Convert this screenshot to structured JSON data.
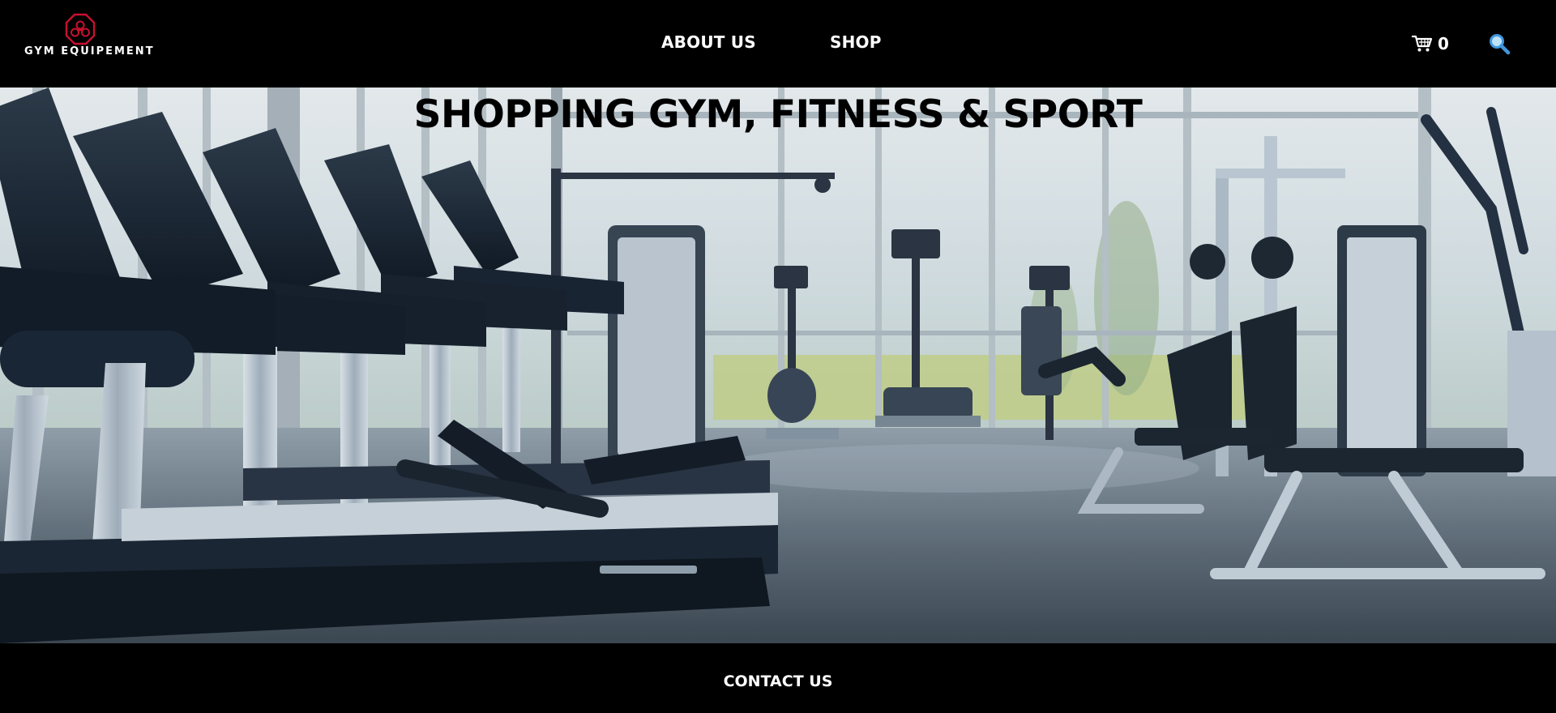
{
  "header": {
    "logo": {
      "text": "GYM EQUIPEMENT",
      "icon": "gym-logo-icon",
      "color": "#c8102e"
    },
    "nav": {
      "about_label": "ABOUT US",
      "shop_label": "SHOP"
    },
    "cart": {
      "icon": "cart-icon",
      "count": "0"
    },
    "search": {
      "icon": "search-icon",
      "color": "#4da3e6"
    }
  },
  "hero": {
    "title": "SHOPPING GYM, FITNESS & SPORT",
    "image": "gym-interior-image"
  },
  "footer": {
    "contact_label": "CONTACT US"
  },
  "colors": {
    "bar_background": "#000000",
    "nav_text": "#ffffff",
    "hero_title": "#000000"
  }
}
